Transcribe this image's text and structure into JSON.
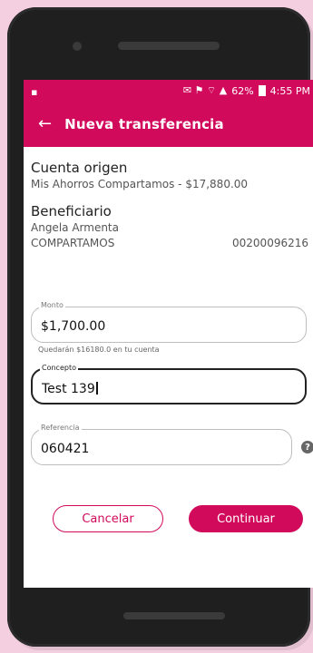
{
  "status_bar": {
    "battery": "62%",
    "time": "4:55 PM"
  },
  "app_bar": {
    "title": "Nueva transferencia"
  },
  "origin": {
    "title": "Cuenta origen",
    "account": "Mis Ahorros Compartamos - $17,880.00"
  },
  "beneficiary": {
    "title": "Beneficiario",
    "name": "Angela Armenta",
    "bank": "COMPARTAMOS",
    "account_number": "00200096216"
  },
  "form": {
    "monto_label": "Monto",
    "monto_value": "$1,700.00",
    "monto_helper": "Quedarán $16180.0 en tu cuenta",
    "concepto_label": "Concepto",
    "concepto_value": "Test 139",
    "referencia_label": "Referencia",
    "referencia_value": "060421"
  },
  "buttons": {
    "cancel": "Cancelar",
    "continue": "Continuar"
  },
  "colors": {
    "brand": "#d10a5c"
  }
}
